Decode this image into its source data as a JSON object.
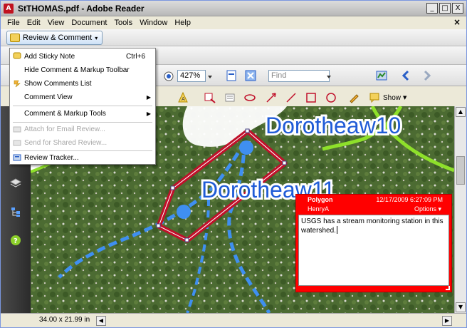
{
  "window": {
    "title": "StTHOMAS.pdf - Adobe Reader",
    "app_icon_glyph": "A",
    "minimize_glyph": "_",
    "maximize_glyph": "□",
    "close_glyph": "X",
    "doc_close_glyph": "×"
  },
  "menubar": {
    "items": [
      "File",
      "Edit",
      "View",
      "Document",
      "Tools",
      "Window",
      "Help"
    ]
  },
  "toolbar": {
    "review_comment_label": "Review & Comment",
    "review_comment_arrow": "▾",
    "zoom_value": "427%",
    "find_placeholder": "Find",
    "show_label": "Show"
  },
  "dropdown": {
    "items": [
      {
        "label": "Add Sticky Note",
        "shortcut": "Ctrl+6",
        "icon": "sticky-note-icon",
        "enabled": true
      },
      {
        "label": "Hide Comment & Markup Toolbar",
        "enabled": true
      },
      {
        "label": "Show Comments List",
        "icon": "comments-list-icon",
        "enabled": true
      },
      {
        "label": "Comment View",
        "submenu": true,
        "enabled": true
      },
      {
        "label": "Comment & Markup Tools",
        "submenu": true,
        "enabled": true
      },
      {
        "label": "Attach for Email Review...",
        "icon": "email-review-icon",
        "enabled": false
      },
      {
        "label": "Send for Shared Review...",
        "icon": "shared-review-icon",
        "enabled": false
      },
      {
        "label": "Review Tracker...",
        "icon": "review-tracker-icon",
        "enabled": true
      }
    ],
    "submenu_arrow": "▶"
  },
  "map": {
    "label_1": "Dorotheaw10",
    "label_2": "Dorotheaw11",
    "label_color": "#1f5bd6",
    "polygon_color": "#c0102a",
    "boundary_color": "#8ee02a",
    "stream_color": "#3f8ff0"
  },
  "annotation": {
    "type": "Polygon",
    "datetime": "12/17/2009 6:27:09 PM",
    "author": "HenryA",
    "options_label": "Options ▾",
    "text": "USGS has a stream monitoring station in this watershed.",
    "color": "#ff0000"
  },
  "status": {
    "page_size": "34.00 x 21.99 in"
  },
  "scroll": {
    "up": "▲",
    "down": "▼",
    "left": "◀",
    "right": "▶"
  }
}
